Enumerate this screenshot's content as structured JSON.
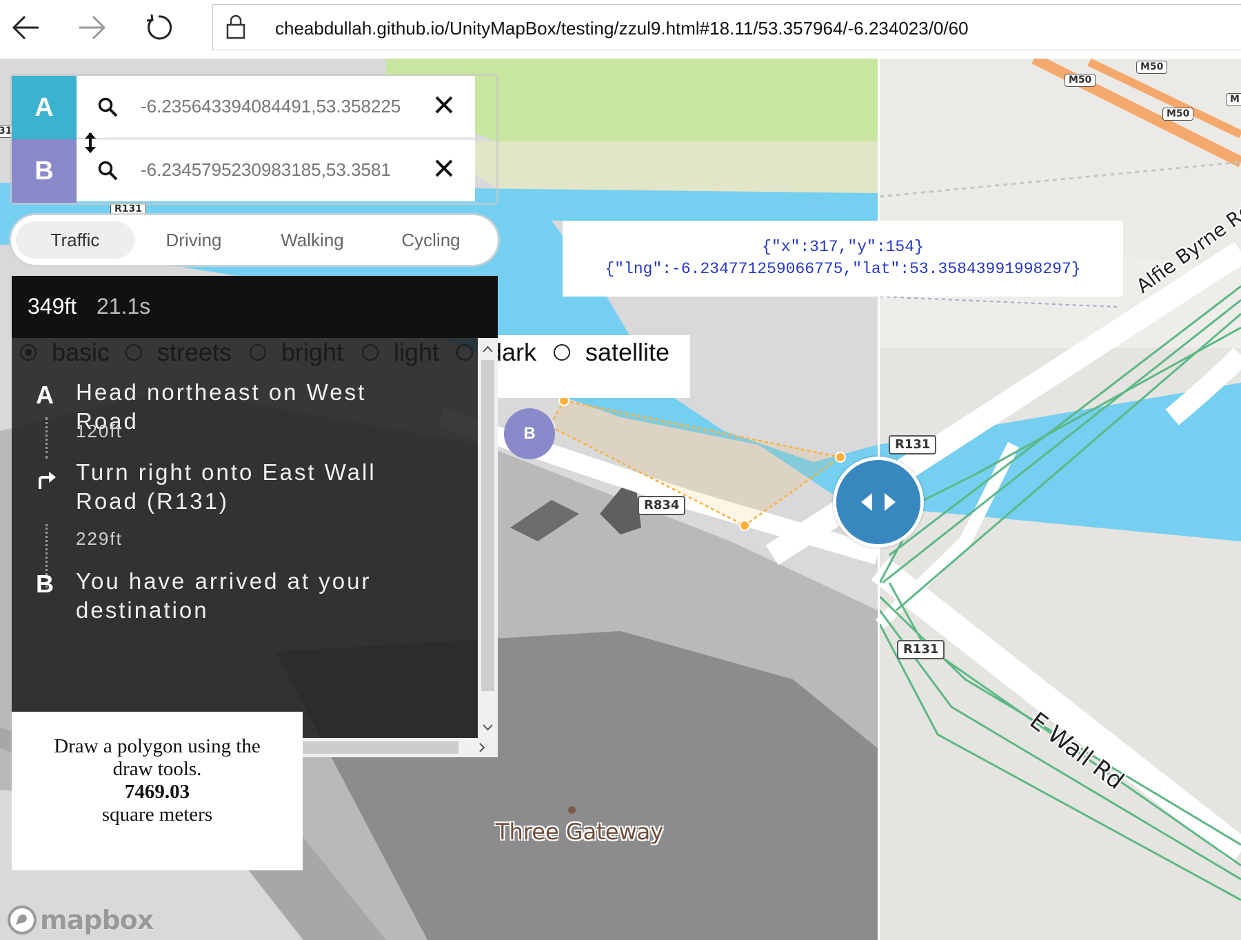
{
  "browser": {
    "url": "cheabdullah.github.io/UnityMapBox/testing/zzul9.html#18.11/53.357964/-6.234023/0/60"
  },
  "directions": {
    "origin_tag": "A",
    "destination_tag": "B",
    "origin_value": "-6.235643394084491,53.358225",
    "destination_value": "-6.2345795230983185,53.3581",
    "profiles": [
      "Traffic",
      "Driving",
      "Walking",
      "Cycling"
    ],
    "active_profile": "Traffic",
    "summary": {
      "distance": "349ft",
      "duration": "21.1s"
    },
    "steps": [
      {
        "icon": "A",
        "text": "Head northeast on West Road",
        "distance": "120ft"
      },
      {
        "icon": "turn-right",
        "text": "Turn right onto East Wall Road (R131)",
        "distance": "229ft"
      },
      {
        "icon": "B",
        "text": "You have arrived at your destination",
        "distance": ""
      }
    ]
  },
  "style_switcher": {
    "options": [
      "basic",
      "streets",
      "bright",
      "light",
      "dark",
      "satellite"
    ],
    "selected": "basic"
  },
  "coords_panel": {
    "line1": "{\"x\":317,\"y\":154}",
    "line2": "{\"lng\":-6.234771259066775,\"lat\":53.35843991998297}"
  },
  "area_panel": {
    "line1": "Draw a polygon using the",
    "line2": "draw tools.",
    "value": "7469.03",
    "unit": "square meters"
  },
  "map_labels": {
    "roads": [
      "M50",
      "M50",
      "M50",
      "M",
      "R131",
      "R131",
      "R834",
      "R131",
      "R131",
      "31"
    ],
    "streets": [
      "Alfie Byrne Rd",
      "E Wall Rd"
    ],
    "poi": "Three Gateway",
    "marker_b": "B",
    "attribution": "mapbox"
  },
  "colors": {
    "route_a": "#3bb2d0",
    "route_b": "#8a8acb",
    "swiper": "#3887be",
    "water": "#75cff0",
    "park": "#c8e6a0",
    "motorway": "#f5a86b",
    "rail": "#5cb885",
    "polygon": "#fbb03b"
  }
}
